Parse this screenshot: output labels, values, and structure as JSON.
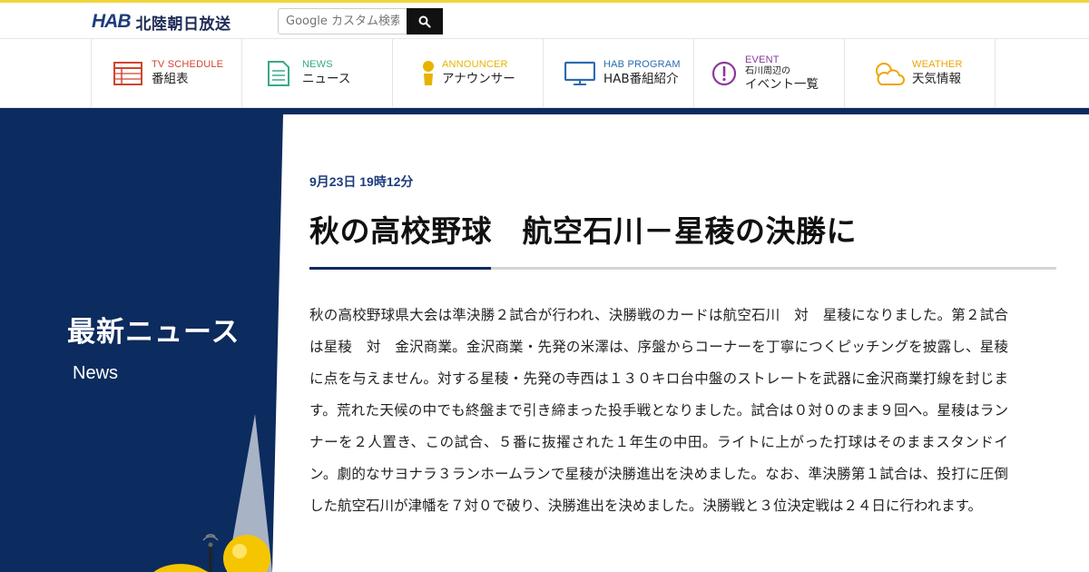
{
  "header": {
    "logo_mark": "HAB",
    "logo_name": "北陸朝日放送",
    "search_placeholder": "Google カスタム検索"
  },
  "nav": [
    {
      "en": "TV SCHEDULE",
      "jp": "番組表",
      "icon": "tv-schedule-icon",
      "color": "#d0452b"
    },
    {
      "en": "NEWS",
      "jp": "ニュース",
      "icon": "news-icon",
      "color": "#3aa88a"
    },
    {
      "en": "ANNOUNCER",
      "jp": "アナウンサー",
      "icon": "announcer-icon",
      "color": "#e6b400"
    },
    {
      "en": "HAB PROGRAM",
      "jp": "HAB番組紹介",
      "icon": "monitor-icon",
      "color": "#2b6cb0"
    },
    {
      "en": "EVENT",
      "jp_small": "石川周辺の",
      "jp": "イベント一覧",
      "icon": "exclamation-circle-icon",
      "color": "#8a3a9a"
    },
    {
      "en": "WEATHER",
      "jp": "天気情報",
      "icon": "weather-icon",
      "color": "#f0a500"
    }
  ],
  "side": {
    "title": "最新ニュース",
    "subtitle": "News"
  },
  "article": {
    "date": "9月23日 19時12分",
    "title": "秋の高校野球　航空石川－星稜の決勝に",
    "body": "秋の高校野球県大会は準決勝２試合が行われ、決勝戦のカードは航空石川　対　星稜になりました。第２試合は星稜　対　金沢商業。金沢商業・先発の米澤は、序盤からコーナーを丁寧につくピッチングを披露し、星稜に点を与えません。対する星稜・先発の寺西は１３０キロ台中盤のストレートを武器に金沢商業打線を封じます。荒れた天候の中でも終盤まで引き締まった投手戦となりました。試合は０対０のまま９回へ。星稜はランナーを２人置き、この試合、５番に抜擢された１年生の中田。ライトに上がった打球はそのままスタンドイン。劇的なサヨナラ３ランホームランで星稜が決勝進出を決めました。なお、準決勝第１試合は、投打に圧倒した航空石川が津幡を７対０で破り、決勝進出を決めました。決勝戦と３位決定戦は２４日に行われます。"
  },
  "colors": {
    "navy": "#0c2b5e",
    "accent_yellow": "#f2d53c"
  }
}
